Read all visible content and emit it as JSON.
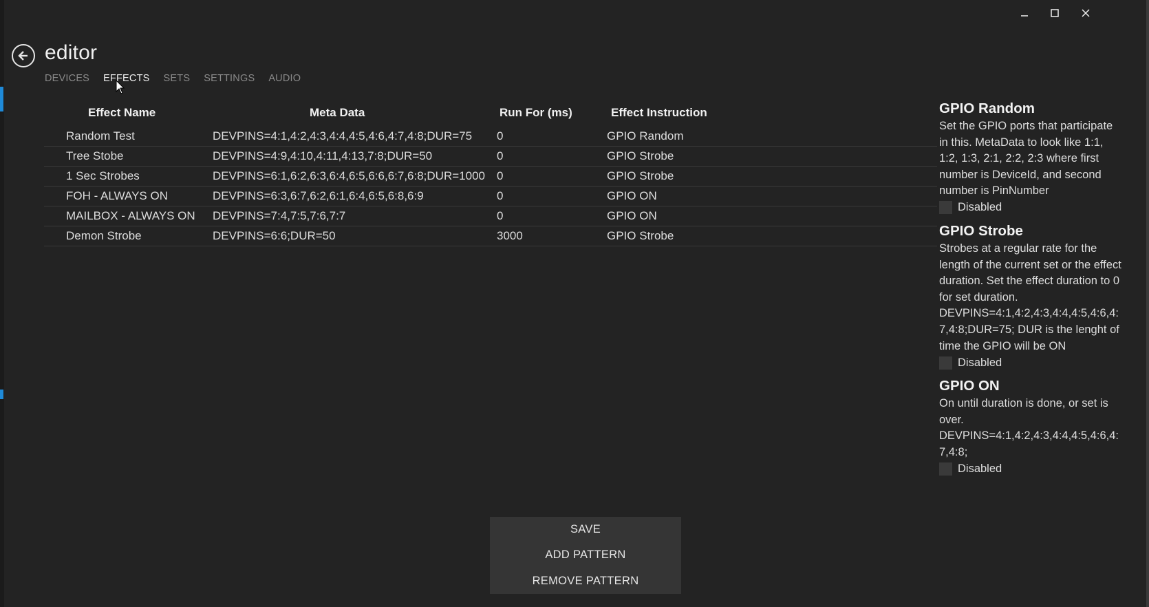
{
  "window": {
    "minimize_icon": "minimize-icon",
    "maximize_icon": "maximize-icon",
    "close_icon": "close-icon"
  },
  "header": {
    "back_icon": "back-arrow-icon",
    "title": "editor"
  },
  "tabs": [
    {
      "label": "DEVICES",
      "active": false
    },
    {
      "label": "EFFECTS",
      "active": true
    },
    {
      "label": "SETS",
      "active": false
    },
    {
      "label": "SETTINGS",
      "active": false
    },
    {
      "label": "AUDIO",
      "active": false
    }
  ],
  "table": {
    "columns": [
      "Effect Name",
      "Meta Data",
      "Run For (ms)",
      "Effect Instruction"
    ],
    "rows": [
      [
        "Random Test",
        "DEVPINS=4:1,4:2,4:3,4:4,4:5,4:6,4:7,4:8;DUR=75",
        "0",
        "GPIO Random"
      ],
      [
        "Tree Stobe",
        "DEVPINS=4:9,4:10,4:11,4:13,7:8;DUR=50",
        "0",
        "GPIO Strobe"
      ],
      [
        "1 Sec Strobes",
        "DEVPINS=6:1,6:2,6:3,6:4,6:5,6:6,6:7,6:8;DUR=1000",
        "0",
        "GPIO Strobe"
      ],
      [
        "FOH - ALWAYS ON",
        "DEVPINS=6:3,6:7,6:2,6:1,6:4,6:5,6:8,6:9",
        "0",
        "GPIO ON"
      ],
      [
        "MAILBOX - ALWAYS ON",
        "DEVPINS=7:4,7:5,7:6,7:7",
        "0",
        "GPIO ON"
      ],
      [
        "Demon Strobe",
        "DEVPINS=6:6;DUR=50",
        "3000",
        "GPIO Strobe"
      ]
    ]
  },
  "instructions": [
    {
      "title": "GPIO Random",
      "description": "Set the GPIO ports that participate in this. MetaData to look like 1:1, 1:2, 1:3, 2:1, 2:2, 2:3 where first number is DeviceId, and second number is PinNumber",
      "checkbox_label": "Disabled"
    },
    {
      "title": "GPIO Strobe",
      "description": "Strobes at a regular rate for the length of the current set or the effect duration. Set the effect duration to 0 for set duration. DEVPINS=4:1,4:2,4:3,4:4,4:5,4:6,4:7,4:8;DUR=75;  DUR is the lenght of time the GPIO will be ON",
      "checkbox_label": "Disabled"
    },
    {
      "title": "GPIO ON",
      "description": "On until duration is done, or set is over. DEVPINS=4:1,4:2,4:3,4:4,4:5,4:6,4:7,4:8;",
      "checkbox_label": "Disabled"
    }
  ],
  "actions": {
    "save": "SAVE",
    "add_pattern": "ADD PATTERN",
    "remove_pattern": "REMOVE PATTERN"
  },
  "colors": {
    "background": "#232323",
    "button_panel": "#353535",
    "accent": "#1f8ad8"
  }
}
